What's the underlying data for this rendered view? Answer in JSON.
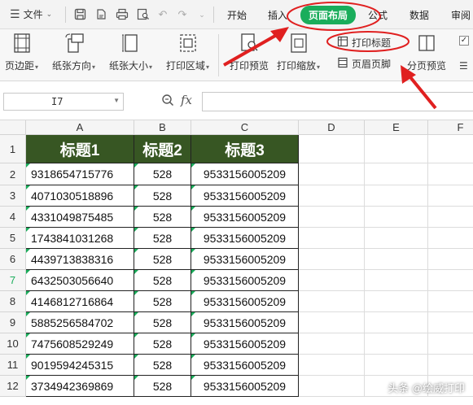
{
  "menubar": {
    "file_label": "文件",
    "tabs": [
      {
        "label": "开始",
        "active": false
      },
      {
        "label": "插入",
        "active": false
      },
      {
        "label": "页面布局",
        "active": true
      },
      {
        "label": "公式",
        "active": false
      },
      {
        "label": "数据",
        "active": false
      },
      {
        "label": "审阅",
        "active": false
      }
    ]
  },
  "ribbon": {
    "margins": "页边距",
    "orientation": "纸张方向",
    "size": "纸张大小",
    "print_area": "打印区域",
    "print_preview": "打印预览",
    "print_scale": "打印缩放",
    "print_titles": "打印标题",
    "header_footer": "页眉页脚",
    "page_break_preview": "分页预览"
  },
  "formula_bar": {
    "cell_ref": "I7",
    "fx": "fx",
    "value": ""
  },
  "columns": [
    "A",
    "B",
    "C",
    "D",
    "E",
    "F"
  ],
  "selected_row": 7,
  "table": {
    "headers": [
      "标题1",
      "标题2",
      "标题3"
    ],
    "rows": [
      [
        "9318654715776",
        "528",
        "9533156005209"
      ],
      [
        "4071030518896",
        "528",
        "9533156005209"
      ],
      [
        "4331049875485",
        "528",
        "9533156005209"
      ],
      [
        "1743841031268",
        "528",
        "9533156005209"
      ],
      [
        "4439713838316",
        "528",
        "9533156005209"
      ],
      [
        "6432503056640",
        "528",
        "9533156005209"
      ],
      [
        "4146812716864",
        "528",
        "9533156005209"
      ],
      [
        "5885256584702",
        "528",
        "9533156005209"
      ],
      [
        "7475608529249",
        "528",
        "9533156005209"
      ],
      [
        "9019594245315",
        "528",
        "9533156005209"
      ],
      [
        "3734942369869",
        "528",
        "9533156005209"
      ]
    ]
  },
  "row_numbers": [
    "1",
    "2",
    "3",
    "4",
    "5",
    "6",
    "7",
    "8",
    "9",
    "10",
    "11",
    "12"
  ],
  "colors": {
    "header_fill": "#375623",
    "accent_green": "#1aad5b",
    "annotation_red": "#e02020"
  },
  "watermark": "头条 @绘威打印"
}
